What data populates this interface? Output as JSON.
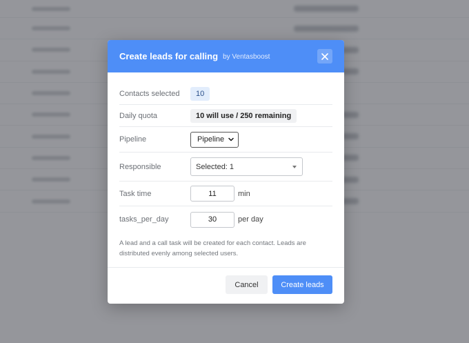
{
  "modal": {
    "title": "Create leads for calling",
    "subtitle": "by Ventasboost",
    "fields": {
      "contacts_selected": {
        "label": "Contacts selected",
        "value": "10"
      },
      "daily_quota": {
        "label": "Daily quota",
        "value": "10 will use / 250 remaining"
      },
      "pipeline": {
        "label": "Pipeline",
        "selected": "Pipeline"
      },
      "responsible": {
        "label": "Responsible",
        "selected": "Selected: 1"
      },
      "task_time": {
        "label": "Task time",
        "value": "11",
        "unit": "min"
      },
      "tasks_per_day": {
        "label": "tasks_per_day",
        "value": "30",
        "unit": "per day"
      }
    },
    "help_text": "A lead and a call task will be created for each contact. Leads are distributed evenly among selected users.",
    "buttons": {
      "cancel": "Cancel",
      "create": "Create leads"
    }
  },
  "icons": {
    "close": "close-icon",
    "pipeline_dropdown": "chevron-down-icon",
    "responsible_dropdown": "caret-down-icon"
  },
  "colors": {
    "accent": "#4e8ef7",
    "badge_blue_bg": "#e2edfc",
    "overlay": "rgba(90,92,98,0.62)"
  }
}
